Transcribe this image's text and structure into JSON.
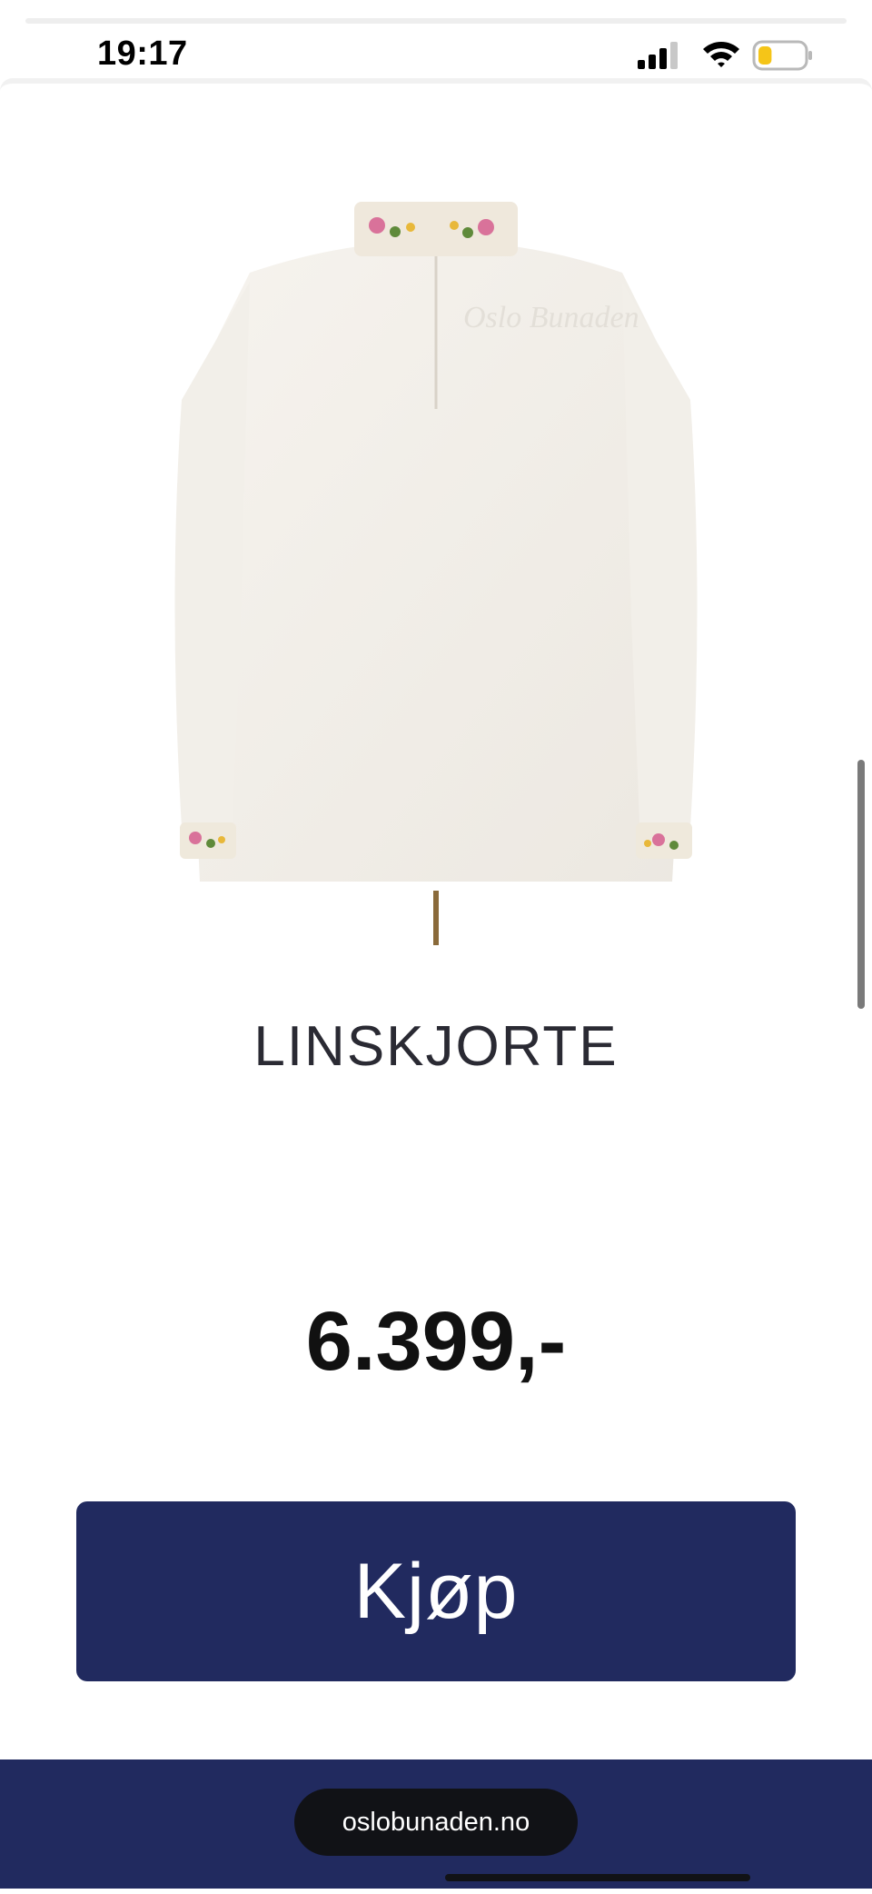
{
  "status_bar": {
    "time": "19:17",
    "battery_level": 0.3,
    "battery_color": "#f5c518"
  },
  "product": {
    "title": "LINSKJORTE",
    "price": "6.399,-",
    "image_watermark": "Oslo Bunaden"
  },
  "buy_button": {
    "label": "Kjøp",
    "color": "#212a5f"
  },
  "footer": {
    "url": "oslobunaden.no",
    "color": "#212a5f"
  }
}
